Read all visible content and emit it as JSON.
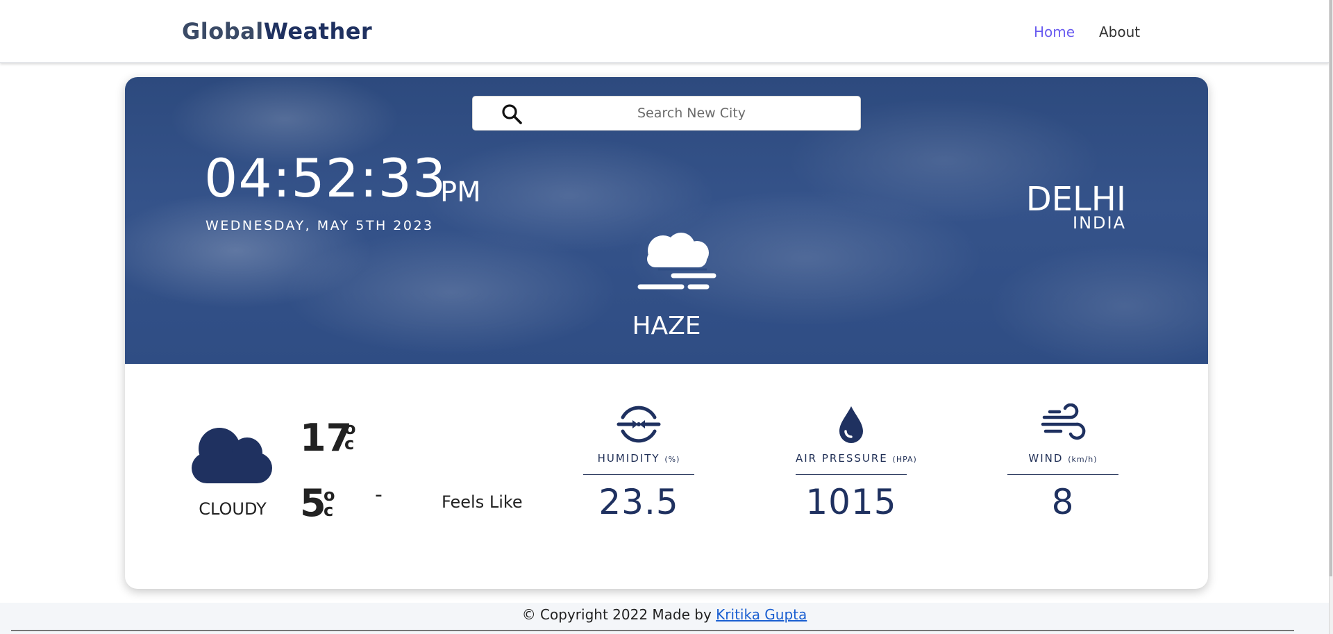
{
  "navbar": {
    "brand_part1": "Global",
    "brand_part2": "Weather",
    "links": [
      {
        "label": "Home",
        "active": true
      },
      {
        "label": "About",
        "active": false
      }
    ]
  },
  "search": {
    "placeholder": "Search New City",
    "icon": "search-icon"
  },
  "time": {
    "clock": "04:52:33",
    "ampm": "PM",
    "date": "WEDNESDAY, MAY 5TH 2023"
  },
  "location": {
    "city": "DELHI",
    "country": "INDIA"
  },
  "current": {
    "icon": "haze-icon",
    "condition": "HAZE"
  },
  "summary": {
    "icon": "cloud-icon",
    "condition": "CLOUDY",
    "temp": "17",
    "temp_unit_top": "o",
    "temp_unit_bottom": "c",
    "feels_temp": "5",
    "feels_unit_top": "o",
    "feels_unit_bottom": "c",
    "dash": "-",
    "feels_label": "Feels Like"
  },
  "metrics": [
    {
      "icon": "humidity-icon",
      "label": "HUMIDITY",
      "unit": "(%)",
      "value": "23.5"
    },
    {
      "icon": "drop-icon",
      "label": "AIR PRESSURE",
      "unit": "(HPA)",
      "value": "1015"
    },
    {
      "icon": "wind-icon",
      "label": "WIND",
      "unit": "(km/h)",
      "value": "8"
    }
  ],
  "footer": {
    "text": "© Copyright 2022 Made by",
    "author": "Kritika Gupta"
  },
  "colors": {
    "hero": "#2f4d84",
    "accent": "#1f3160",
    "nav_active": "#6a5cf0",
    "link": "#1a5fd1"
  }
}
